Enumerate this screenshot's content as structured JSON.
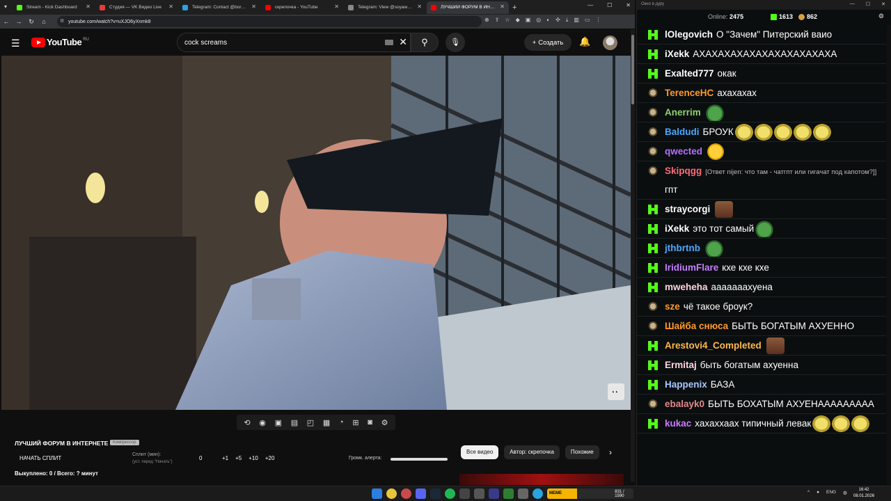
{
  "browser": {
    "tabs": [
      {
        "title": "Stream - Kick Dashboard",
        "color": "#53fc18",
        "active": false
      },
      {
        "title": "Студия — VK Видео Live",
        "color": "#e63b3b",
        "active": false
      },
      {
        "title": "Telegram: Contact @boris_rock",
        "color": "#2aa3e0",
        "active": false
      },
      {
        "title": "скрепочка - YouTube",
        "color": "#ff0000",
        "active": false
      },
      {
        "title": "Telegram: View @soyawrld",
        "color": "#888888",
        "active": false
      },
      {
        "title": "ЛУЧШИЙ ФОРУМ В ИНТЕРНЕТЕ",
        "color": "#ff0000",
        "active": true
      }
    ],
    "url": "youtube.com/watch?v=uXJO6yXnmk8"
  },
  "youtube": {
    "region": "RU",
    "logo": "YouTube",
    "search_value": "cock screams",
    "create_label": "Создать"
  },
  "panel": {
    "channel_title": "ЛУЧШИЙ ФОРУМ В ИНТЕРНЕТЕ",
    "badge": "Компрессор",
    "start_split": "НАЧАТЬ СПЛИТ",
    "split_label": "Сплит (мин):",
    "split_sub": "(уст. перед \"Начать\")",
    "split_value": "0",
    "increments": [
      "+1",
      "+5",
      "+10",
      "+20"
    ],
    "alert_label": "Громк. алерта:",
    "alert_volume": 1.0,
    "bought": "Выкуплено: 0 / Всего: ? минут"
  },
  "chips": [
    "Все видео",
    "Автор: скрепочка",
    "Похожие"
  ],
  "chat": {
    "window_title": "Окно в дуру",
    "online_label": "Online:",
    "online_value": "2475",
    "kick_count": "1613",
    "coin_count": "862",
    "messages": [
      {
        "badge": "k",
        "nick": "lOlegovich",
        "color": "#ffffff",
        "text": "О \"Зачем\" Питерский ваио",
        "emotes": []
      },
      {
        "badge": "k",
        "nick": "iXekk",
        "color": "#ffffff",
        "text": "АХАХАХАХАХАХАХАХАХАХАХА",
        "emotes": []
      },
      {
        "badge": "k",
        "nick": "Exalted777",
        "color": "#ffffff",
        "text": "окак",
        "emotes": []
      },
      {
        "badge": "c",
        "nick": "TerenceHC",
        "color": "#ff9a2e",
        "text": "ахахахах",
        "emotes": []
      },
      {
        "badge": "c",
        "nick": "Anerrim",
        "color": "#8fd36a",
        "text": "",
        "emotes": [
          "pepe"
        ]
      },
      {
        "badge": "c",
        "nick": "Baldudi",
        "color": "#4aa8ff",
        "text": "БРОУК",
        "emotes": [
          "troll",
          "troll",
          "troll",
          "troll",
          "troll"
        ]
      },
      {
        "badge": "c",
        "nick": "qwected",
        "color": "#b470ff",
        "text": "",
        "emotes": [
          "cry"
        ]
      },
      {
        "badge": "c",
        "nick": "Skipqgg",
        "color": "#ff6b7a",
        "reply": "[Ответ nijen: что там - чатгпт или гигачат под капотом?]]",
        "text": "гпт",
        "emotes": []
      },
      {
        "badge": "k",
        "nick": "straycorgi",
        "color": "#ffffff",
        "text": "",
        "emotes": [
          "face"
        ]
      },
      {
        "badge": "k",
        "nick": "iXekk",
        "color": "#ffffff",
        "text": "это тот самый",
        "emotes": [
          "pepe"
        ]
      },
      {
        "badge": "k",
        "nick": "jthbrtnb",
        "color": "#4aa8ff",
        "text": "",
        "emotes": [
          "pepe"
        ]
      },
      {
        "badge": "k",
        "nick": "IridiumFlare",
        "color": "#c77dff",
        "text": "кхе кхе кхе",
        "emotes": []
      },
      {
        "badge": "k",
        "nick": "mweheha",
        "color": "#ffd6e0",
        "text": "ааааааахуена",
        "emotes": []
      },
      {
        "badge": "c",
        "nick": "sze",
        "color": "#ff9a2e",
        "text": "чё такое броук?",
        "emotes": []
      },
      {
        "badge": "c",
        "nick": "Шайба снюса",
        "color": "#ff9a2e",
        "text": "БЫТЬ БОГАТЫМ АХУЕННО",
        "emotes": []
      },
      {
        "badge": "k",
        "nick": "Arestovi4_Completed",
        "color": "#ffb84d",
        "text": "",
        "emotes": [
          "face"
        ]
      },
      {
        "badge": "k",
        "nick": "Ermitaj",
        "color": "#ffd6e0",
        "text": "быть богатым ахуенна",
        "emotes": []
      },
      {
        "badge": "k",
        "nick": "Happenix",
        "color": "#a6c8ff",
        "text": "БАЗА",
        "emotes": []
      },
      {
        "badge": "c",
        "nick": "ebalayk0",
        "color": "#e08a8a",
        "text": "БЫТЬ БОХАТЫМ АХУЕНААААААААА",
        "emotes": []
      },
      {
        "badge": "k",
        "nick": "kukac",
        "color": "#c77dff",
        "text": "хахаххаах типичный левак",
        "emotes": [
          "troll",
          "troll",
          "troll"
        ]
      }
    ]
  },
  "taskbar": {
    "widget_label": "MEME PARTY",
    "widget_count": "831 / 1590",
    "lang": "ENG",
    "time": "16:42",
    "date": "08.01.2026"
  }
}
